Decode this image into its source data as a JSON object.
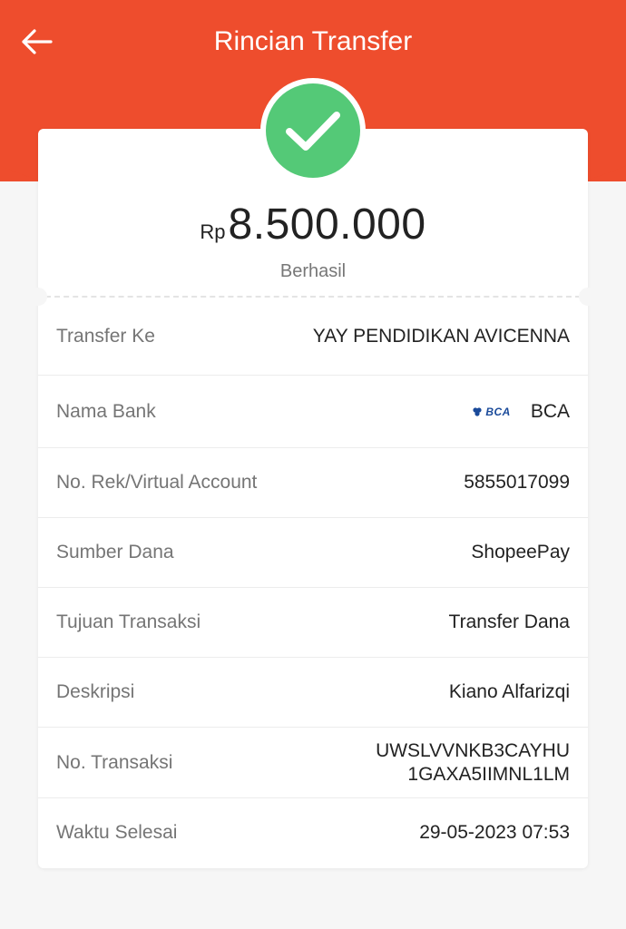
{
  "header": {
    "title": "Rincian Transfer",
    "back_icon": "arrow-left-icon"
  },
  "colors": {
    "brand_orange": "#ee4d2d",
    "success_green": "#54c977",
    "bca_blue": "#1a4a9a"
  },
  "summary": {
    "currency": "Rp",
    "amount": "8.500.000",
    "status": "Berhasil",
    "status_icon": "check-icon"
  },
  "details": {
    "transfer_to": {
      "label": "Transfer Ke",
      "value": "YAY PENDIDIKAN AVICENNA"
    },
    "bank": {
      "label": "Nama Bank",
      "logo_text": "BCA",
      "value": "BCA"
    },
    "account": {
      "label": "No. Rek/Virtual Account",
      "value": "5855017099"
    },
    "source": {
      "label": "Sumber Dana",
      "value": "ShopeePay"
    },
    "purpose": {
      "label": "Tujuan Transaksi",
      "value": "Transfer Dana"
    },
    "description": {
      "label": "Deskripsi",
      "value": "Kiano Alfarizqi"
    },
    "transaction_no": {
      "label": "No. Transaksi",
      "value_line1": "UWSLVVNKB3CAYHU",
      "value_line2": "1GAXA5IIMNL1LM"
    },
    "completed_at": {
      "label": "Waktu Selesai",
      "value": "29-05-2023 07:53"
    }
  }
}
